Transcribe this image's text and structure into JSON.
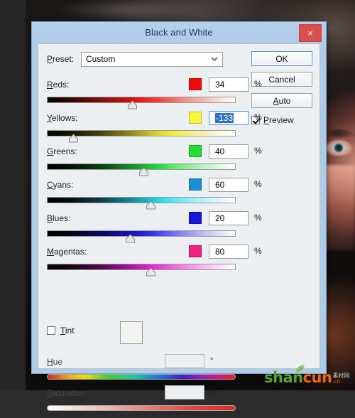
{
  "window": {
    "title": "Black and White",
    "close_label": "×"
  },
  "preset": {
    "label": "Preset:",
    "label_mnemonic": "P",
    "value": "Custom",
    "chevron": "∨",
    "menu_icon": "preset-options-icon"
  },
  "buttons": {
    "ok": "OK",
    "cancel": "Cancel",
    "auto": "Auto",
    "preview_label": "Preview",
    "preview_checked": true
  },
  "channels": [
    {
      "name": "Reds:",
      "mnemonic": "R",
      "value": "34",
      "unit": "%",
      "swatch": "#f40a0a",
      "thumb_pct": 45,
      "focused": false,
      "gradient": "linear-gradient(90deg,#000000 0%,#3a0606 14%,#8f0f0f 32%,#e01515 48%,#f53a3a 58%,#f08a80 72%,#f3c9c2 86%,#ffffff 100%)"
    },
    {
      "name": "Yellows:",
      "mnemonic": "Y",
      "value": "-133",
      "unit": "%",
      "swatch": "#fbf73c",
      "thumb_pct": 14,
      "focused": true,
      "gradient": "linear-gradient(90deg,#000000 0%,#151404 12%,#45420a 28%,#8e8a16 44%,#d8d224 58%,#f2ee3c 66%,#f4f19b 80%,#fbfade 92%,#ffffff 100%)"
    },
    {
      "name": "Greens:",
      "mnemonic": "G",
      "value": "40",
      "unit": "%",
      "swatch": "#22e033",
      "thumb_pct": 51,
      "focused": false,
      "gradient": "linear-gradient(90deg,#000000 0%,#041206 12%,#0a3a14 28%,#12962b 46%,#1fd83a 58%,#6aec78 70%,#bdf5c2 84%,#ffffff 100%)"
    },
    {
      "name": "Cyans:",
      "mnemonic": "C",
      "value": "60",
      "unit": "%",
      "swatch": "#1890d8",
      "thumb_pct": 55,
      "focused": false,
      "gradient": "linear-gradient(90deg,#000000 0%,#031011 12%,#0a3d44 28%,#0f8e9c 45%,#1ad4e6 58%,#6ceaf3 70%,#bdf4f8 84%,#ffffff 100%)"
    },
    {
      "name": "Blues:",
      "mnemonic": "B",
      "value": "20",
      "unit": "%",
      "swatch": "#1616d8",
      "thumb_pct": 44,
      "focused": false,
      "gradient": "linear-gradient(90deg,#000000 0%,#040418 12%,#0a0a5a 28%,#1414b4 44%,#2a2ae8 54%,#7272f0 68%,#c0c0f6 84%,#ffffff 100%)"
    },
    {
      "name": "Magentas:",
      "mnemonic": "M",
      "value": "80",
      "unit": "%",
      "swatch": "#f51f7e",
      "thumb_pct": 55,
      "focused": false,
      "gradient": "linear-gradient(90deg,#000000 0%,#140414 12%,#4f0a4c 28%,#a512a0 44%,#e428d6 56%,#ef6ce2 68%,#f7bdf0 84%,#ffffff 100%)"
    }
  ],
  "tint": {
    "label": "Tint",
    "mnemonic": "T",
    "checked": false,
    "swatch_color": "#f2f2f0",
    "hue": {
      "label": "Hue",
      "mnemonic": "H",
      "value": "",
      "unit": "°"
    },
    "saturation": {
      "label": "Saturation",
      "mnemonic": "S",
      "value": "",
      "unit": "%"
    }
  },
  "watermark": {
    "brand_first": "shan",
    "brand_second": "cun",
    "cn_text": "素材网",
    "url_text": ".cn"
  }
}
